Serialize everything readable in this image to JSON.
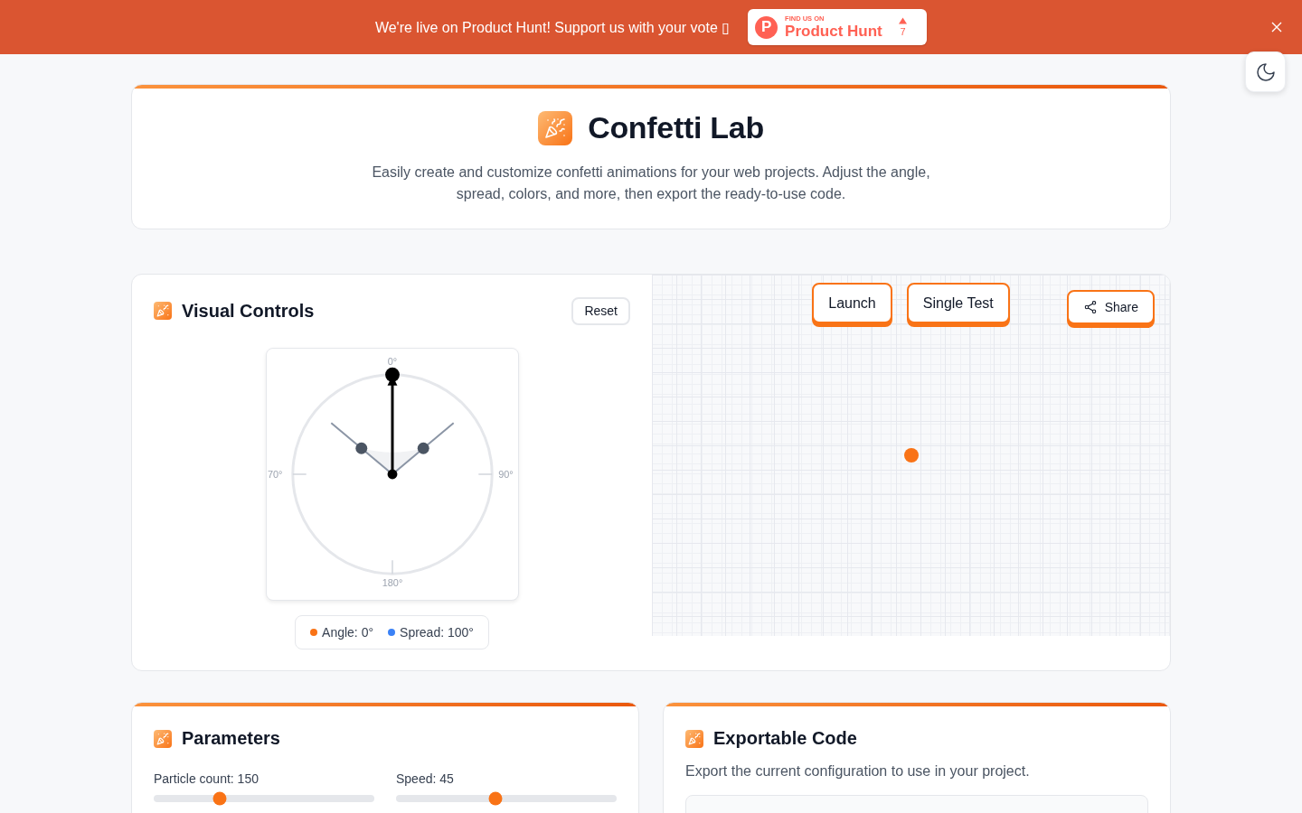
{
  "banner": {
    "message": "We're live on Product Hunt! Support us with your vote ▯",
    "badge": {
      "logo_letter": "P",
      "kicker": "FIND US ON",
      "name": "Product Hunt",
      "votes": "7"
    }
  },
  "header": {
    "title": "Confetti Lab",
    "description": "Easily create and customize confetti animations for your web projects. Adjust the angle, spread, colors, and more, then export the ready-to-use code."
  },
  "visual_controls": {
    "title": "Visual Controls",
    "reset_label": "Reset",
    "dial": {
      "label_top": "0°",
      "label_right": "90°",
      "label_bottom": "180°",
      "label_left": "70°"
    },
    "legend": [
      {
        "label": "Angle: 0°",
        "color": "#f97316"
      },
      {
        "label": "Spread: 100°",
        "color": "#3b82f6"
      }
    ]
  },
  "preview": {
    "actions": [
      {
        "label": "Launch"
      },
      {
        "label": "Single Test"
      }
    ],
    "share_label": "Share"
  },
  "parameters": {
    "title": "Parameters",
    "sliders": [
      {
        "label": "Particle count: 150",
        "level": 0.3
      },
      {
        "label": "Speed: 45",
        "level": 0.45
      }
    ]
  },
  "export": {
    "title": "Exportable Code",
    "description": "Export the current configuration to use in your project."
  }
}
